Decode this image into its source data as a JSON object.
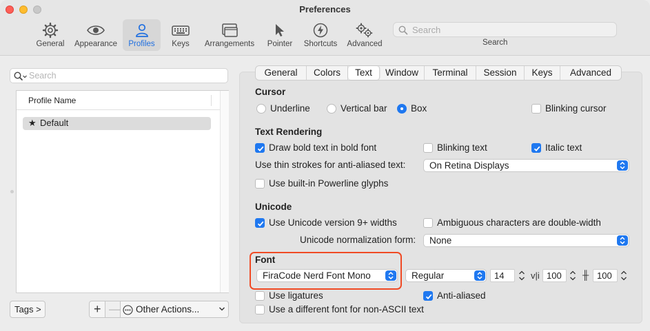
{
  "window": {
    "title": "Preferences"
  },
  "toolbar": {
    "items": [
      {
        "label": "General",
        "icon": "gear-icon"
      },
      {
        "label": "Appearance",
        "icon": "eye-icon"
      },
      {
        "label": "Profiles",
        "icon": "person-icon",
        "active": true
      },
      {
        "label": "Keys",
        "icon": "keyboard-icon"
      },
      {
        "label": "Arrangements",
        "icon": "windows-icon"
      },
      {
        "label": "Pointer",
        "icon": "pointer-icon"
      },
      {
        "label": "Shortcuts",
        "icon": "bolt-icon"
      },
      {
        "label": "Advanced",
        "icon": "gears-icon"
      }
    ],
    "search_placeholder": "Search",
    "search_caption": "Search"
  },
  "profiles_pane": {
    "search_placeholder": "Search",
    "column_header": "Profile Name",
    "items": [
      {
        "star": "★",
        "name": "Default"
      }
    ],
    "tags_button": "Tags >",
    "add_button": "+",
    "remove_button": "—",
    "other_actions": "Other Actions..."
  },
  "tabs": [
    "General",
    "Colors",
    "Text",
    "Window",
    "Terminal",
    "Session",
    "Keys",
    "Advanced"
  ],
  "selected_tab": "Text",
  "cursor": {
    "title": "Cursor",
    "options": [
      "Underline",
      "Vertical bar",
      "Box"
    ],
    "selected": "Box",
    "blinking_label": "Blinking cursor",
    "blinking": false
  },
  "text_rendering": {
    "title": "Text Rendering",
    "bold_label": "Draw bold text in bold font",
    "bold": true,
    "blinking_text_label": "Blinking text",
    "blinking_text": false,
    "italic_label": "Italic text",
    "italic": true,
    "thin_strokes_label": "Use thin strokes for anti-aliased text:",
    "thin_strokes_value": "On Retina Displays",
    "powerline_label": "Use built-in Powerline glyphs",
    "powerline": false
  },
  "unicode": {
    "title": "Unicode",
    "v9_label": "Use Unicode version 9+ widths",
    "v9": true,
    "ambiguous_label": "Ambiguous characters are double-width",
    "ambiguous": false,
    "normalization_label": "Unicode normalization form:",
    "normalization_value": "None"
  },
  "font": {
    "title": "Font",
    "family": "FiraCode Nerd Font Mono",
    "weight": "Regular",
    "size": "14",
    "h_spacing_glyph": "v|i",
    "h_spacing": "100",
    "v_spacing_glyph": "╫",
    "v_spacing": "100",
    "ligatures_label": "Use ligatures",
    "ligatures": false,
    "antialiased_label": "Anti-aliased",
    "antialiased": true,
    "non_ascii_label": "Use a different font for non-ASCII text",
    "non_ascii": false
  },
  "colors": {
    "accent": "#1f78f0",
    "highlight": "#f04a24"
  }
}
